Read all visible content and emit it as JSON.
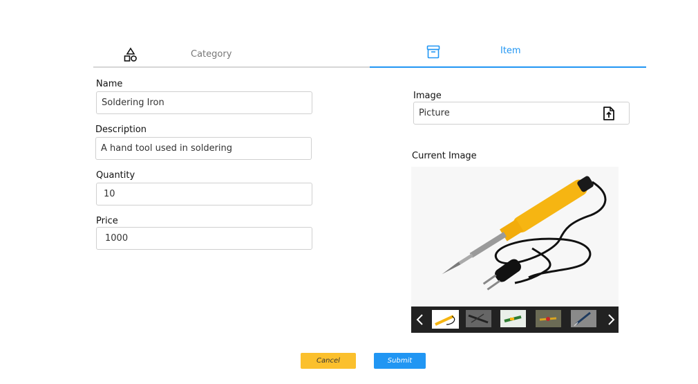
{
  "tabs": [
    {
      "label": "Category",
      "icon": "shapes-icon",
      "active": false
    },
    {
      "label": "Item",
      "icon": "archive-icon",
      "active": true
    }
  ],
  "form": {
    "name": {
      "label": "Name",
      "value": "Soldering Iron"
    },
    "description": {
      "label": "Description",
      "value": "A hand tool used in soldering"
    },
    "quantity": {
      "label": "Quantity",
      "value": "10"
    },
    "price": {
      "label": "Price",
      "value": "1000"
    },
    "image": {
      "label": "Image",
      "value": "Picture",
      "icon": "file-upload-icon"
    }
  },
  "current_image": {
    "label": "Current Image",
    "thumbnail_count": 5,
    "selected_index": 0
  },
  "actions": {
    "cancel_label": "Cancel",
    "submit_label": "Submit"
  },
  "colors": {
    "accent": "#2196f3",
    "cancel": "#fbc02d",
    "tab_inactive_border": "#d6d6d6"
  }
}
